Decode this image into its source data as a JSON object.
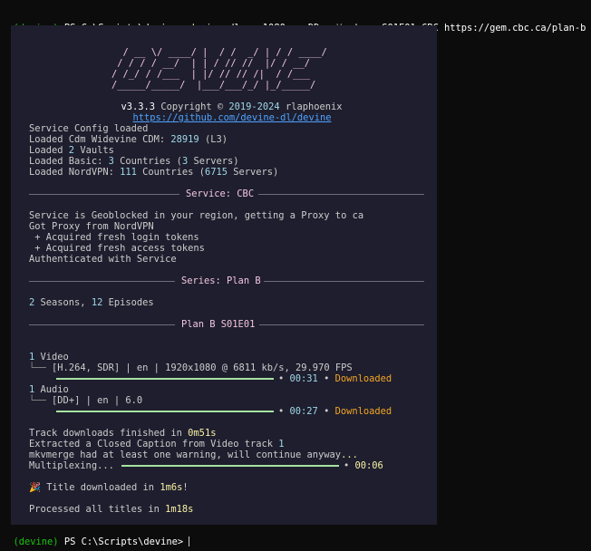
{
  "prompt": {
    "env": "(devine)",
    "ps": " PS C:\\Scripts\\devine> ",
    "cmd": "devine",
    "args_a": " dl ",
    "flag_q": "-q",
    "q_val": " 1080 ",
    "flag_a": "-a",
    "a_val": " DD+ ",
    "flag_V": "-V",
    "sp1": " ",
    "flag_A": "-A",
    "sp2": " ",
    "flag_w": "-w",
    "rest": " S01E01 CBC https://gem.cbc.ca/plan-b"
  },
  "logo": {
    "line1": "  / __ \\/ ____/ |  / /  _/ | / / ____/",
    "line2": " / / / / __/  | | / // //  |/ / __/   ",
    "line3": "/ /_/ / /___  | |/ // // /|  / /___   ",
    "line4": "/_____/_____/  |___/___/_/ |_/_____/    "
  },
  "version": {
    "ver": "v3.3.3",
    "copy": " Copyright © ",
    "years": "2019-2024",
    "author": " rlaphoenix",
    "url": "https://github.com/devine-dl/devine"
  },
  "config": {
    "l1": "Service Config loaded",
    "l2a": "Loaded Cdm Widevine CDM: ",
    "l2b": "28919",
    "l2c": " (L3)",
    "l3a": "Loaded ",
    "l3b": "2",
    "l3c": " Vaults",
    "l4a": "Loaded Basic: ",
    "l4b": "3",
    "l4c": " Countries (",
    "l4d": "3",
    "l4e": " Servers)",
    "l5a": "Loaded NordVPN: ",
    "l5b": "111",
    "l5c": " Countries (",
    "l5d": "6715",
    "l5e": " Servers)"
  },
  "service_rule": "Service: CBC",
  "service": {
    "l1": "Service is Geoblocked in your region, getting a Proxy to ca",
    "l2": "Got Proxy from NordVPN",
    "l3": " + Acquired fresh login tokens",
    "l4": " + Acquired fresh access tokens",
    "l5": "Authenticated with Service"
  },
  "series_rule": "Series: Plan B",
  "series": {
    "s_num": "2",
    "s_txt": " Seasons, ",
    "e_num": "12",
    "e_txt": " Episodes"
  },
  "episode_rule": "Plan B S01E01",
  "tracks": {
    "video_num": "1",
    "video_label": " Video",
    "video_info": "[H.264, SDR] | en | 1920x1080 @ 6811 kb/s, 29.970 FPS",
    "video_time": "00:31",
    "video_status": "Downloaded",
    "video_progress": 1.0,
    "audio_num": "1",
    "audio_label": " Audio",
    "audio_info": "[DD+] | en | 6.0",
    "audio_time": "00:27",
    "audio_status": "Downloaded",
    "audio_progress": 1.0,
    "tree_glyph": "└──",
    "dot": "•"
  },
  "finish": {
    "l1a": "Track downloads finished in ",
    "l1b": "0m51s",
    "l2a": "Extracted a Closed Caption from Video track ",
    "l2b": "1",
    "l3a": "mkvmerge had at least one warning, will continue anyway",
    "l3b": "...",
    "l4a": "Multiplexing",
    "l4b": "...",
    "mux_time": "00:06",
    "mux_progress": 1.0,
    "title_emoji": "🎉",
    "title_a": " Title downloaded in ",
    "title_b": "1m6s",
    "title_c": "!",
    "all_a": "Processed all titles in ",
    "all_b": "1m18s"
  },
  "prompt2": {
    "env": "(devine)",
    "ps": " PS C:\\Scripts\\devine> "
  }
}
